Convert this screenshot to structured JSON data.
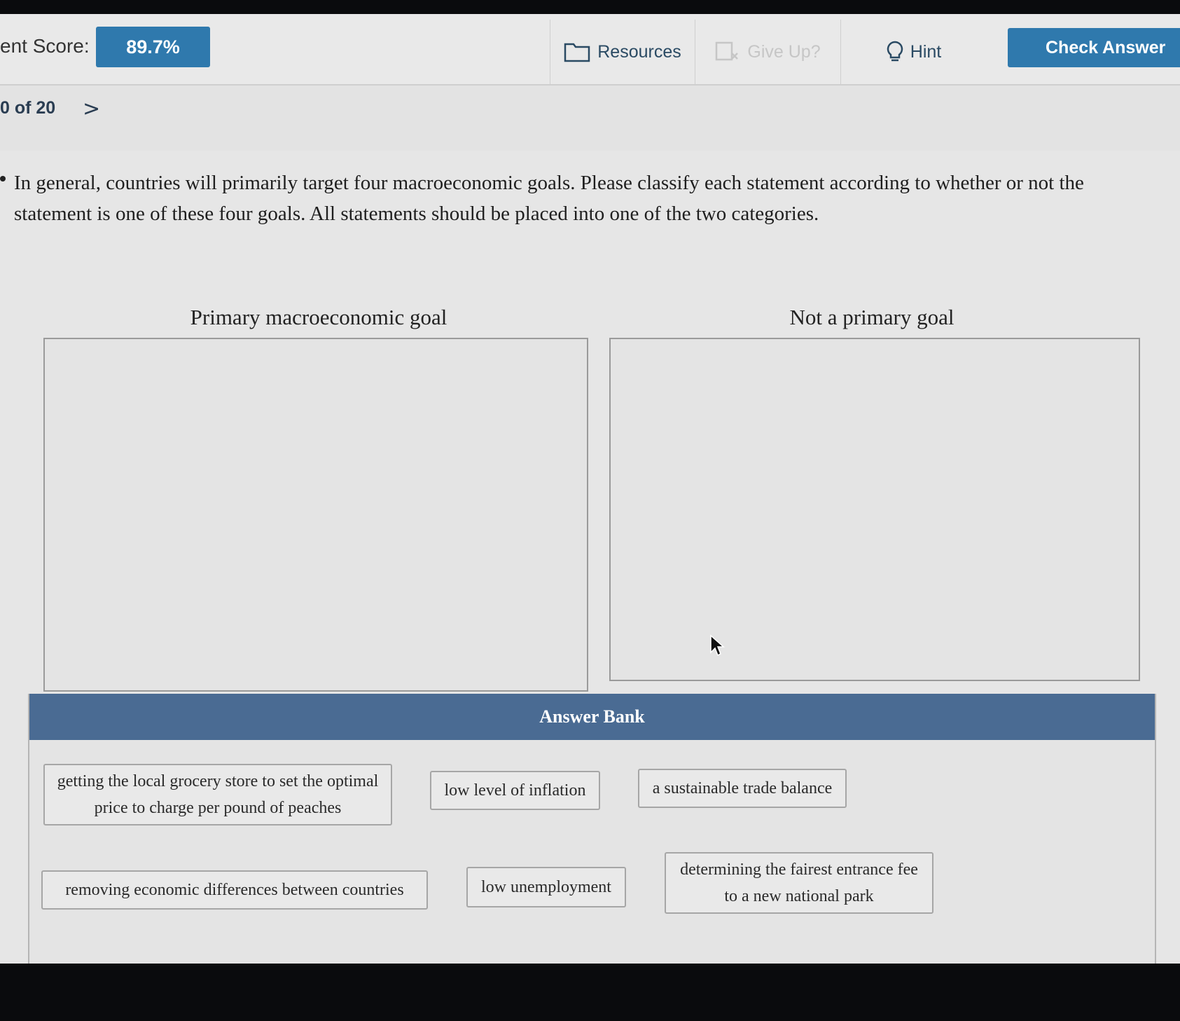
{
  "header": {
    "score_label": "ent Score:",
    "score_value": "89.7%",
    "resources_label": "Resources",
    "give_up_label": "Give Up?",
    "hint_label": "Hint",
    "check_answer_label": "Check Answer"
  },
  "navigation": {
    "question_position": "0 of 20",
    "next_glyph": ">"
  },
  "question": {
    "text": "In general, countries will primarily target four macroeconomic goals. Please classify each statement according to whether or not the statement is one of these four goals. All statements should be placed into one of the two categories."
  },
  "categories": [
    {
      "label": "Primary macroeconomic goal"
    },
    {
      "label": "Not a primary goal"
    }
  ],
  "answer_bank": {
    "title": "Answer Bank",
    "items": [
      "getting the local grocery store to set the optimal price to charge per pound of peaches",
      "low level of inflation",
      "a sustainable trade balance",
      "removing economic differences between countries",
      "low unemployment",
      "determining the fairest entrance fee to a new national park"
    ]
  },
  "colors": {
    "accent_blue": "#2f79ad",
    "bank_header": "#4a6b93",
    "disabled_text": "#c6c6c6"
  }
}
